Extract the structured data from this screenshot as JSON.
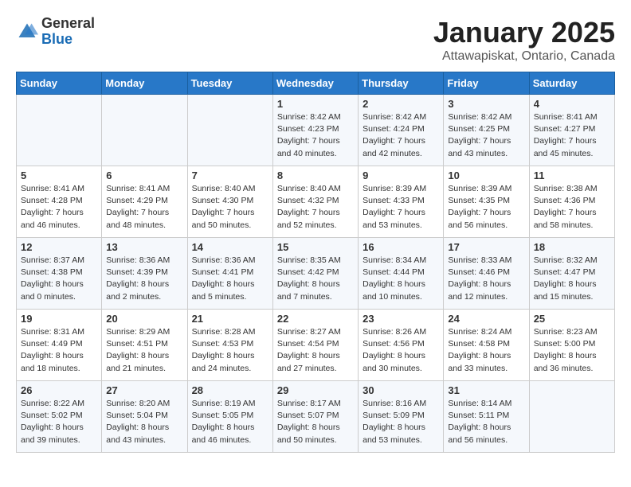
{
  "header": {
    "logo_general": "General",
    "logo_blue": "Blue",
    "title": "January 2025",
    "subtitle": "Attawapiskat, Ontario, Canada"
  },
  "weekdays": [
    "Sunday",
    "Monday",
    "Tuesday",
    "Wednesday",
    "Thursday",
    "Friday",
    "Saturday"
  ],
  "weeks": [
    [
      {
        "day": "",
        "content": ""
      },
      {
        "day": "",
        "content": ""
      },
      {
        "day": "",
        "content": ""
      },
      {
        "day": "1",
        "content": "Sunrise: 8:42 AM\nSunset: 4:23 PM\nDaylight: 7 hours\nand 40 minutes."
      },
      {
        "day": "2",
        "content": "Sunrise: 8:42 AM\nSunset: 4:24 PM\nDaylight: 7 hours\nand 42 minutes."
      },
      {
        "day": "3",
        "content": "Sunrise: 8:42 AM\nSunset: 4:25 PM\nDaylight: 7 hours\nand 43 minutes."
      },
      {
        "day": "4",
        "content": "Sunrise: 8:41 AM\nSunset: 4:27 PM\nDaylight: 7 hours\nand 45 minutes."
      }
    ],
    [
      {
        "day": "5",
        "content": "Sunrise: 8:41 AM\nSunset: 4:28 PM\nDaylight: 7 hours\nand 46 minutes."
      },
      {
        "day": "6",
        "content": "Sunrise: 8:41 AM\nSunset: 4:29 PM\nDaylight: 7 hours\nand 48 minutes."
      },
      {
        "day": "7",
        "content": "Sunrise: 8:40 AM\nSunset: 4:30 PM\nDaylight: 7 hours\nand 50 minutes."
      },
      {
        "day": "8",
        "content": "Sunrise: 8:40 AM\nSunset: 4:32 PM\nDaylight: 7 hours\nand 52 minutes."
      },
      {
        "day": "9",
        "content": "Sunrise: 8:39 AM\nSunset: 4:33 PM\nDaylight: 7 hours\nand 53 minutes."
      },
      {
        "day": "10",
        "content": "Sunrise: 8:39 AM\nSunset: 4:35 PM\nDaylight: 7 hours\nand 56 minutes."
      },
      {
        "day": "11",
        "content": "Sunrise: 8:38 AM\nSunset: 4:36 PM\nDaylight: 7 hours\nand 58 minutes."
      }
    ],
    [
      {
        "day": "12",
        "content": "Sunrise: 8:37 AM\nSunset: 4:38 PM\nDaylight: 8 hours\nand 0 minutes."
      },
      {
        "day": "13",
        "content": "Sunrise: 8:36 AM\nSunset: 4:39 PM\nDaylight: 8 hours\nand 2 minutes."
      },
      {
        "day": "14",
        "content": "Sunrise: 8:36 AM\nSunset: 4:41 PM\nDaylight: 8 hours\nand 5 minutes."
      },
      {
        "day": "15",
        "content": "Sunrise: 8:35 AM\nSunset: 4:42 PM\nDaylight: 8 hours\nand 7 minutes."
      },
      {
        "day": "16",
        "content": "Sunrise: 8:34 AM\nSunset: 4:44 PM\nDaylight: 8 hours\nand 10 minutes."
      },
      {
        "day": "17",
        "content": "Sunrise: 8:33 AM\nSunset: 4:46 PM\nDaylight: 8 hours\nand 12 minutes."
      },
      {
        "day": "18",
        "content": "Sunrise: 8:32 AM\nSunset: 4:47 PM\nDaylight: 8 hours\nand 15 minutes."
      }
    ],
    [
      {
        "day": "19",
        "content": "Sunrise: 8:31 AM\nSunset: 4:49 PM\nDaylight: 8 hours\nand 18 minutes."
      },
      {
        "day": "20",
        "content": "Sunrise: 8:29 AM\nSunset: 4:51 PM\nDaylight: 8 hours\nand 21 minutes."
      },
      {
        "day": "21",
        "content": "Sunrise: 8:28 AM\nSunset: 4:53 PM\nDaylight: 8 hours\nand 24 minutes."
      },
      {
        "day": "22",
        "content": "Sunrise: 8:27 AM\nSunset: 4:54 PM\nDaylight: 8 hours\nand 27 minutes."
      },
      {
        "day": "23",
        "content": "Sunrise: 8:26 AM\nSunset: 4:56 PM\nDaylight: 8 hours\nand 30 minutes."
      },
      {
        "day": "24",
        "content": "Sunrise: 8:24 AM\nSunset: 4:58 PM\nDaylight: 8 hours\nand 33 minutes."
      },
      {
        "day": "25",
        "content": "Sunrise: 8:23 AM\nSunset: 5:00 PM\nDaylight: 8 hours\nand 36 minutes."
      }
    ],
    [
      {
        "day": "26",
        "content": "Sunrise: 8:22 AM\nSunset: 5:02 PM\nDaylight: 8 hours\nand 39 minutes."
      },
      {
        "day": "27",
        "content": "Sunrise: 8:20 AM\nSunset: 5:04 PM\nDaylight: 8 hours\nand 43 minutes."
      },
      {
        "day": "28",
        "content": "Sunrise: 8:19 AM\nSunset: 5:05 PM\nDaylight: 8 hours\nand 46 minutes."
      },
      {
        "day": "29",
        "content": "Sunrise: 8:17 AM\nSunset: 5:07 PM\nDaylight: 8 hours\nand 50 minutes."
      },
      {
        "day": "30",
        "content": "Sunrise: 8:16 AM\nSunset: 5:09 PM\nDaylight: 8 hours\nand 53 minutes."
      },
      {
        "day": "31",
        "content": "Sunrise: 8:14 AM\nSunset: 5:11 PM\nDaylight: 8 hours\nand 56 minutes."
      },
      {
        "day": "",
        "content": ""
      }
    ]
  ]
}
